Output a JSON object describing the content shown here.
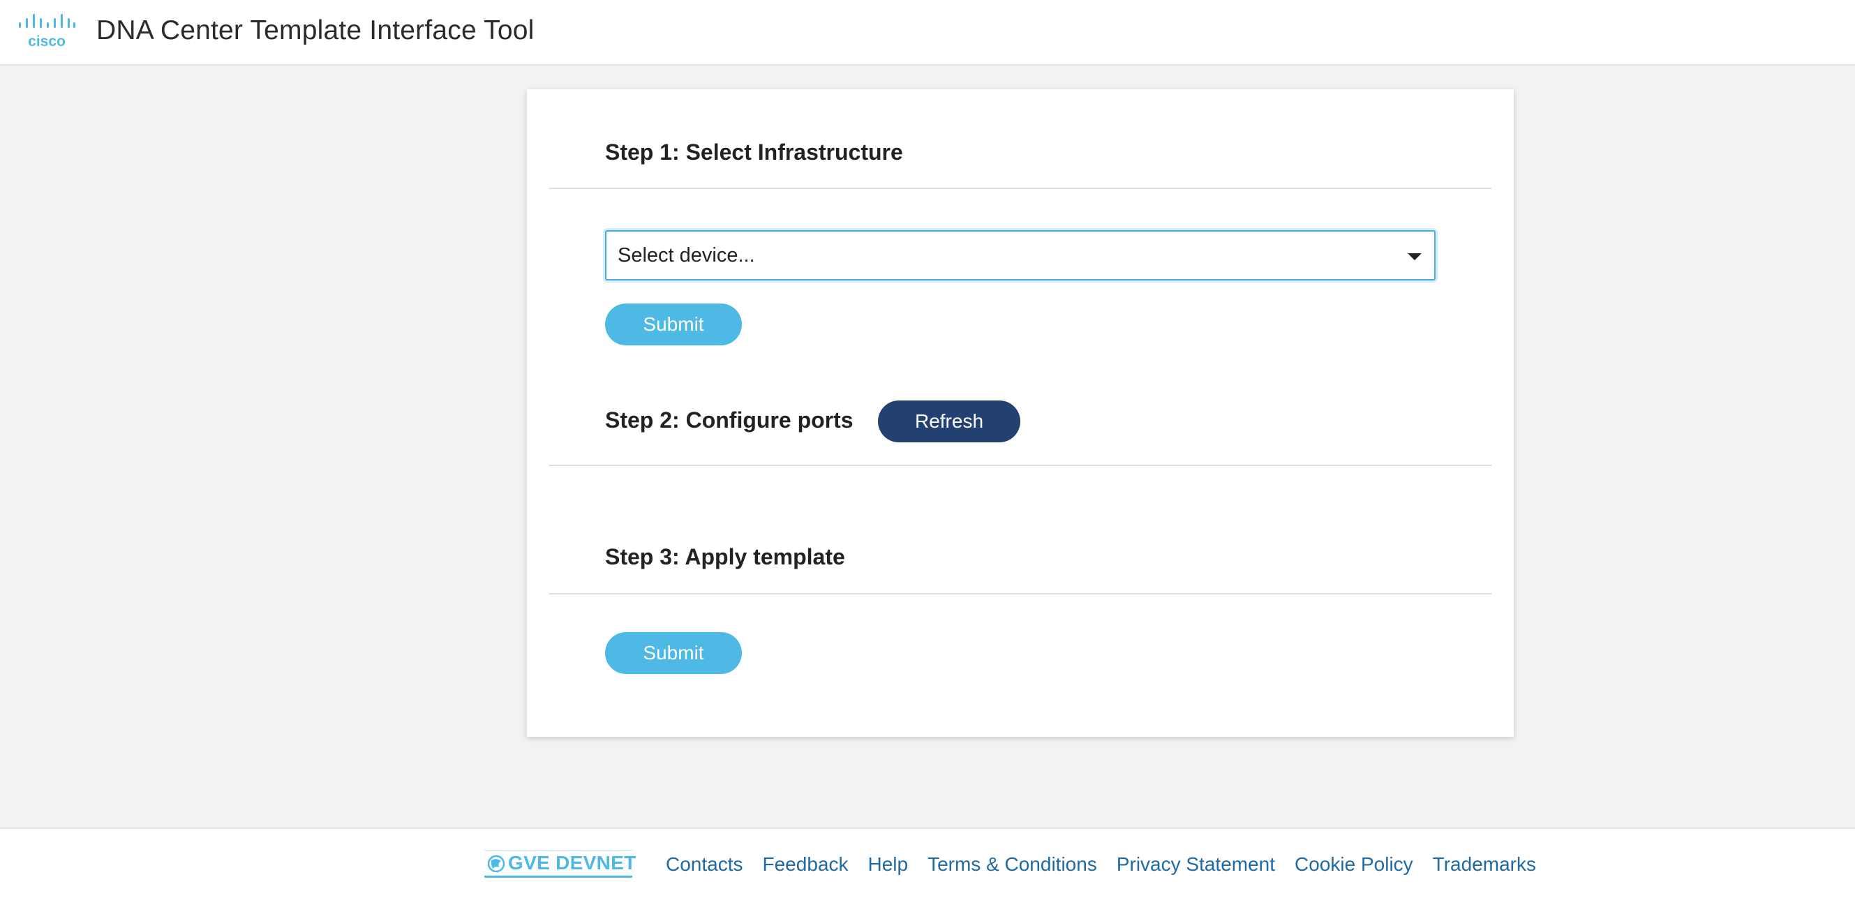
{
  "header": {
    "logo_text": "cisco",
    "title": "DNA Center Template Interface Tool"
  },
  "steps": {
    "step1": {
      "heading": "Step 1: Select Infrastructure",
      "device_select_value": "Select device...",
      "submit_label": "Submit"
    },
    "step2": {
      "heading": "Step 2: Configure ports",
      "refresh_label": "Refresh"
    },
    "step3": {
      "heading": "Step 3: Apply template",
      "submit_label": "Submit"
    }
  },
  "footer": {
    "brand": "GVE DEVNET",
    "links": [
      "Contacts",
      "Feedback",
      "Help",
      "Terms & Conditions",
      "Privacy Statement",
      "Cookie Policy",
      "Trademarks"
    ]
  },
  "colors": {
    "accent_light": "#4fb9e6",
    "accent_dark": "#234170",
    "link": "#1f6aa5",
    "background": "#f2f2f2"
  },
  "icons": [
    "cisco-logo-icon",
    "chevron-down-icon",
    "globe-icon"
  ]
}
